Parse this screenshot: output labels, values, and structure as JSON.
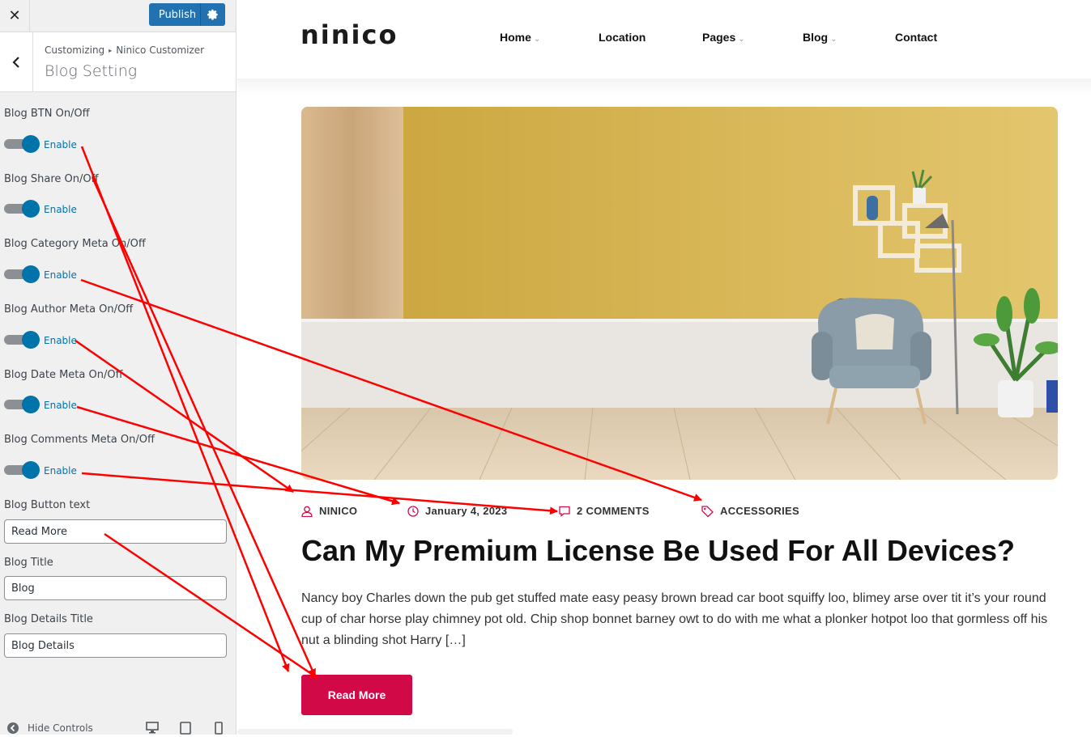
{
  "customizer": {
    "close_icon": "close-icon",
    "publish_label": "Publish",
    "breadcrumb": {
      "root": "Customizing",
      "parent": "Ninico Customizer"
    },
    "section_title": "Blog Setting",
    "toggles": [
      {
        "label": "Blog BTN On/Off",
        "state_text": "Enable",
        "enabled": true
      },
      {
        "label": "Blog Share On/Off",
        "state_text": "Enable",
        "enabled": true
      },
      {
        "label": "Blog Category Meta On/Off",
        "state_text": "Enable",
        "enabled": true
      },
      {
        "label": "Blog Author Meta On/Off",
        "state_text": "Enable",
        "enabled": true
      },
      {
        "label": "Blog Date Meta On/Off",
        "state_text": "Enable",
        "enabled": true
      },
      {
        "label": "Blog Comments Meta On/Off",
        "state_text": "Enable",
        "enabled": true
      }
    ],
    "text_fields": [
      {
        "label": "Blog Button text",
        "value": "Read More"
      },
      {
        "label": "Blog Title",
        "value": "Blog"
      },
      {
        "label": "Blog Details Title",
        "value": "Blog Details"
      }
    ],
    "footer": {
      "hide_controls": "Hide Controls"
    }
  },
  "site": {
    "logo": "ninico",
    "nav": [
      {
        "label": "Home",
        "has_dropdown": true
      },
      {
        "label": "Location",
        "has_dropdown": false
      },
      {
        "label": "Pages",
        "has_dropdown": true
      },
      {
        "label": "Blog",
        "has_dropdown": true
      },
      {
        "label": "Contact",
        "has_dropdown": false
      }
    ]
  },
  "post": {
    "author": "NINICO",
    "date": "January 4, 2023",
    "comments": "2 COMMENTS",
    "category": "ACCESSORIES",
    "title": "Can My Premium License Be Used For All Devices?",
    "excerpt": "Nancy boy Charles down the pub get stuffed mate easy peasy brown bread car boot squiffy loo, blimey arse over tit it’s your round cup of char horse play chimney pot old. Chip shop bonnet barney owt to do with me what a plonker hotpot loo that gormless off his nut a blinding shot Harry […]",
    "read_more": "Read More"
  },
  "colors": {
    "accent": "#d10a47",
    "wp_blue": "#2271b1",
    "toggle_blue": "#0073aa",
    "annotation": "#ff0000"
  }
}
